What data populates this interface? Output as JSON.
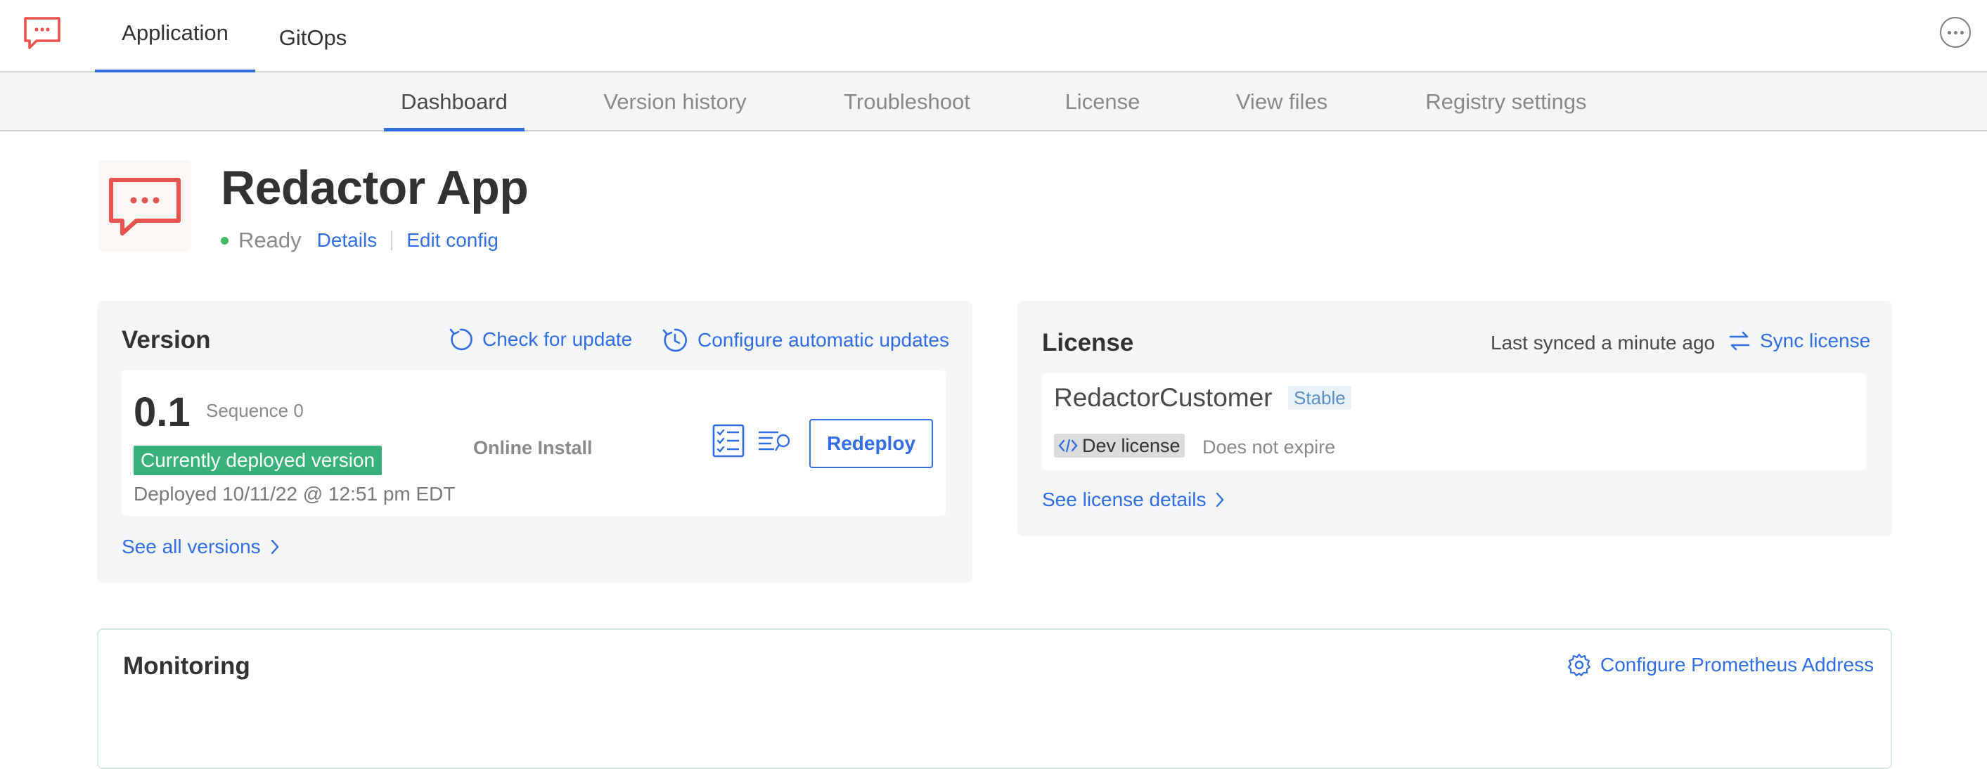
{
  "topnav": {
    "tabs": [
      {
        "label": "Application",
        "active": true
      },
      {
        "label": "GitOps",
        "active": false
      }
    ],
    "logo_icon": "chat-bubble-icon",
    "more_icon": "more-horizontal-icon"
  },
  "subnav": {
    "tabs": [
      {
        "label": "Dashboard",
        "active": true
      },
      {
        "label": "Version history",
        "active": false
      },
      {
        "label": "Troubleshoot",
        "active": false
      },
      {
        "label": "License",
        "active": false
      },
      {
        "label": "View files",
        "active": false
      },
      {
        "label": "Registry settings",
        "active": false
      }
    ]
  },
  "app": {
    "name": "Redactor App",
    "status": "Ready",
    "details_link": "Details",
    "edit_config_link": "Edit config",
    "status_color": "#44bb66",
    "brand_color": "#e8524f"
  },
  "version": {
    "title": "Version",
    "check_update": "Check for update",
    "configure_updates": "Configure automatic updates",
    "number": "0.1",
    "sequence": "Sequence 0",
    "badge": "Currently deployed version",
    "deployed": "Deployed 10/11/22 @ 12:51 pm EDT",
    "source": "Online Install",
    "redeploy": "Redeploy",
    "see_all": "See all versions",
    "badge_color": "#38b27a"
  },
  "license": {
    "title": "License",
    "last_synced": "Last synced a minute ago",
    "sync": "Sync license",
    "customer": "RedactorCustomer",
    "channel": "Stable",
    "type": "Dev license",
    "expiration": "Does not expire",
    "see_details": "See license details"
  },
  "monitoring": {
    "title": "Monitoring",
    "configure": "Configure Prometheus Address"
  },
  "accent_color": "#326de6"
}
